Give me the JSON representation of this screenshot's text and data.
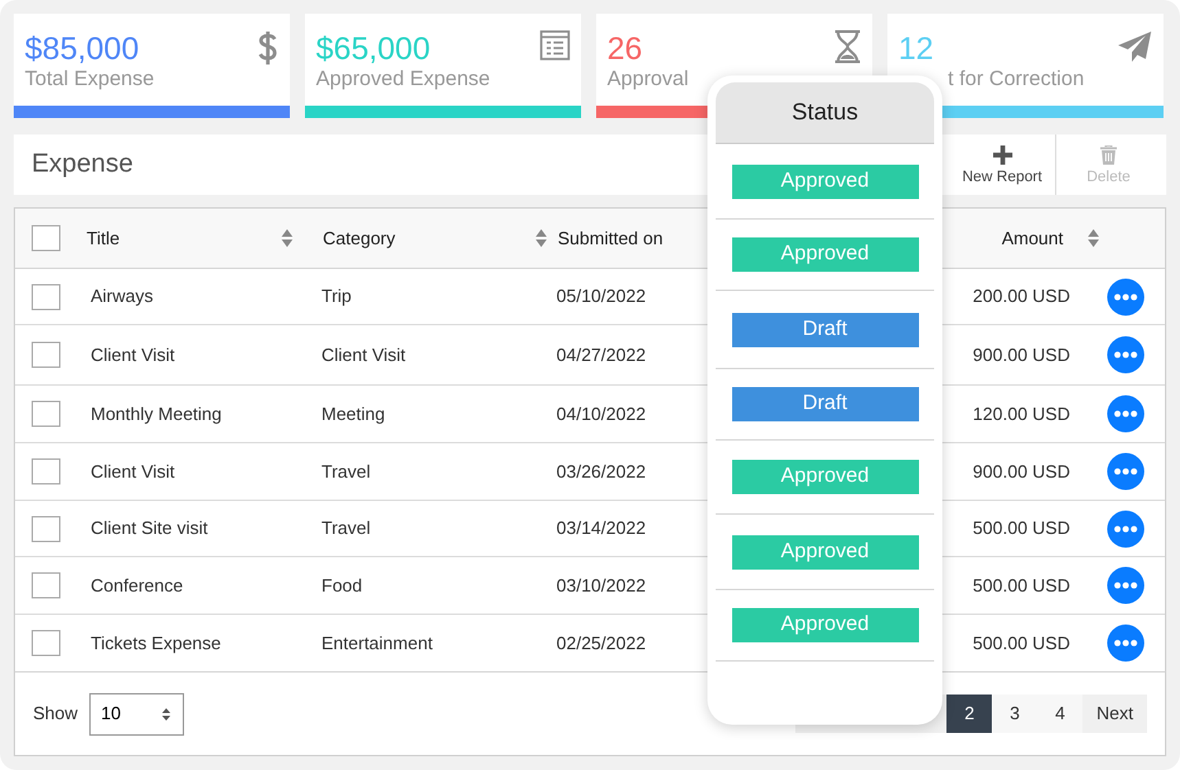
{
  "cards": [
    {
      "value": "$85,000",
      "label": "Total Expense",
      "color": "#4f86f7"
    },
    {
      "value": "$65,000",
      "label": "Approved Expense",
      "color": "#2ad4c6"
    },
    {
      "value": "26",
      "label": "Approval",
      "color": "#f66666"
    },
    {
      "value": "12",
      "label": "t for Correction",
      "color": "#5ccff3"
    }
  ],
  "toolbar": {
    "title": "Expense",
    "actions": [
      {
        "label": "New Report",
        "disabled": false
      },
      {
        "label": "Delete",
        "disabled": true
      }
    ]
  },
  "table": {
    "columns": [
      "Title",
      "Category",
      "Submitted on",
      "Amount"
    ],
    "header_checked": false,
    "rows": [
      {
        "checked": false,
        "title": "Airways",
        "category": "Trip",
        "submitted": "05/10/2022",
        "amount": "200.00 USD"
      },
      {
        "checked": false,
        "title": "Client Visit",
        "category": "Client Visit",
        "submitted": "04/27/2022",
        "amount": "900.00 USD"
      },
      {
        "checked": false,
        "title": "Monthly Meeting",
        "category": "Meeting",
        "submitted": "04/10/2022",
        "amount": "120.00 USD"
      },
      {
        "checked": false,
        "title": "Client Visit",
        "category": "Travel",
        "submitted": "03/26/2022",
        "amount": "900.00 USD"
      },
      {
        "checked": false,
        "title": "Client Site visit",
        "category": "Travel",
        "submitted": "03/14/2022",
        "amount": "500.00 USD"
      },
      {
        "checked": false,
        "title": "Conference",
        "category": "Food",
        "submitted": "03/10/2022",
        "amount": "500.00 USD"
      },
      {
        "checked": false,
        "title": "Tickets Expense",
        "category": "Entertainment",
        "submitted": "02/25/2022",
        "amount": "500.00 USD"
      }
    ]
  },
  "footer": {
    "show_label": "Show",
    "page_size": "10",
    "pages": [
      {
        "label": "2",
        "selected": true
      },
      {
        "label": "3",
        "selected": false
      },
      {
        "label": "4",
        "selected": false
      }
    ],
    "next": "Next"
  },
  "status_popup": {
    "title": "Status",
    "items": [
      {
        "label": "Approved",
        "kind": "approved"
      },
      {
        "label": "Approved",
        "kind": "approved"
      },
      {
        "label": "Draft",
        "kind": "draft"
      },
      {
        "label": "Draft",
        "kind": "draft"
      },
      {
        "label": "Approved",
        "kind": "approved"
      },
      {
        "label": "Approved",
        "kind": "approved"
      },
      {
        "label": "Approved",
        "kind": "approved"
      }
    ]
  }
}
